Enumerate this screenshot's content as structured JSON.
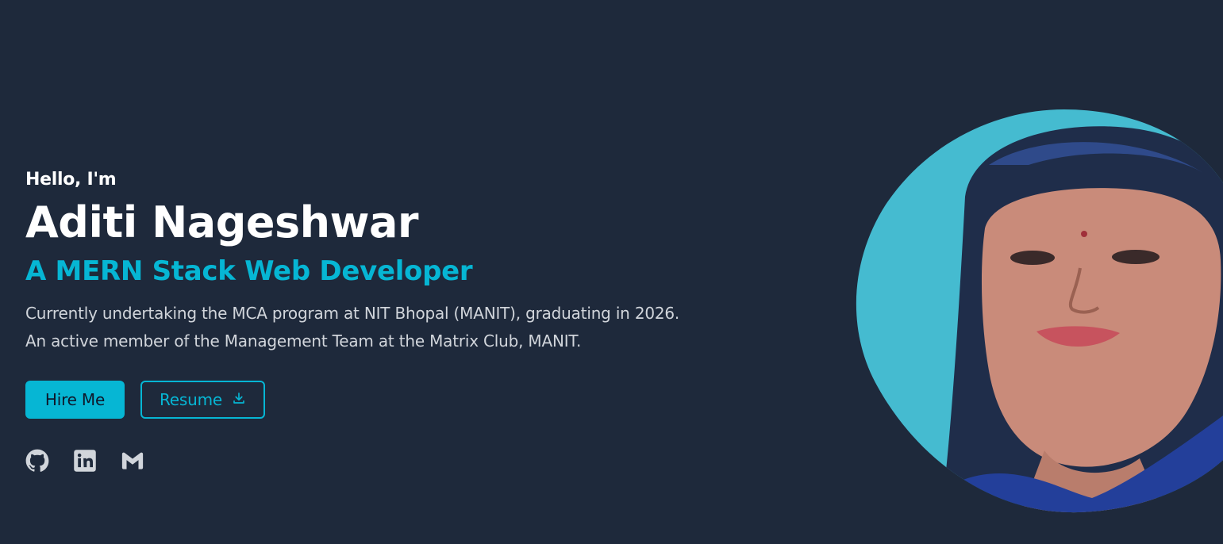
{
  "hero": {
    "greeting": "Hello, I'm",
    "name": "Aditi Nageshwar",
    "role": "A MERN Stack Web Developer",
    "bio_line1": "Currently undertaking the MCA program at NIT Bhopal (MANIT), graduating in 2026.",
    "bio_line2": "An active member of the Management Team at the Matrix Club, MANIT."
  },
  "buttons": {
    "hire_label": "Hire Me",
    "resume_label": "Resume",
    "resume_icon": "download-icon"
  },
  "social": [
    {
      "icon": "github-icon"
    },
    {
      "icon": "linkedin-icon"
    },
    {
      "icon": "gmail-icon"
    }
  ],
  "colors": {
    "background": "#1e293b",
    "accent": "#06b6d4",
    "text": "#ffffff",
    "muted_text": "#d1d5db",
    "portrait_bg": "#45bbd0"
  }
}
